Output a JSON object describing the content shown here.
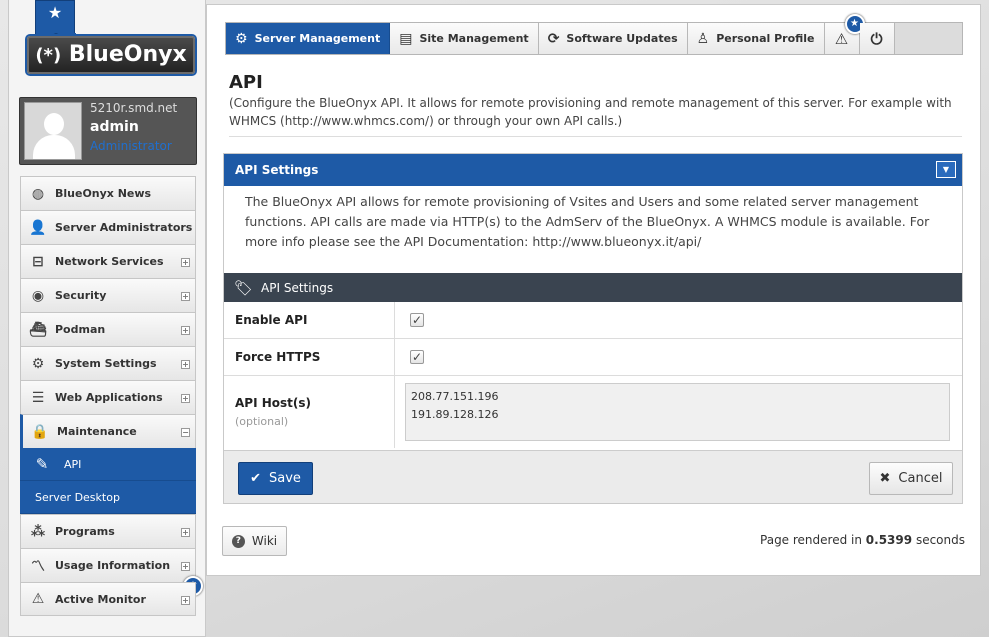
{
  "logo": {
    "brand": "BlueOnyx",
    "mark": "(*)"
  },
  "user": {
    "host": "5210r.smd.net",
    "name": "admin",
    "role": "Administrator"
  },
  "sidebar": {
    "items": [
      {
        "label": "BlueOnyx News",
        "icon": "globe-icon"
      },
      {
        "label": "Server Administrators",
        "icon": "users-icon"
      },
      {
        "label": "Network Services",
        "icon": "network-icon",
        "toggle": "+"
      },
      {
        "label": "Security",
        "icon": "eye-icon",
        "toggle": "+"
      },
      {
        "label": "Podman",
        "icon": "container-icon",
        "toggle": "+"
      },
      {
        "label": "System Settings",
        "icon": "gear-icon",
        "toggle": "+"
      },
      {
        "label": "Web Applications",
        "icon": "server-icon",
        "toggle": "+"
      },
      {
        "label": "Maintenance",
        "icon": "lock-icon",
        "toggle": "−",
        "expanded": true
      },
      {
        "label": "Programs",
        "icon": "programs-icon",
        "toggle": "+"
      },
      {
        "label": "Usage Information",
        "icon": "chart-icon",
        "toggle": "+"
      },
      {
        "label": "Active Monitor",
        "icon": "warning-icon",
        "toggle": "+"
      }
    ],
    "sub_items": [
      {
        "label": "API",
        "active": true
      },
      {
        "label": "Server Desktop"
      }
    ]
  },
  "topnav": {
    "tabs": [
      {
        "label": "Server Management",
        "active": true
      },
      {
        "label": "Site Management"
      },
      {
        "label": "Software Updates"
      },
      {
        "label": "Personal Profile"
      }
    ]
  },
  "page": {
    "title": "API",
    "description": "(Configure the BlueOnyx API. It allows for remote provisioning and remote management of this server. For example with WHMCS (http://www.whmcs.com/) or through your own API calls.)"
  },
  "settings": {
    "header": "API Settings",
    "intro": "The BlueOnyx API allows for remote provisioning of Vsites and Users and some related server management functions. API calls are made via HTTP(s) to the AdmServ of the BlueOnyx. A WHMCS module is available. For more info please see the API Documentation: http://www.blueonyx.it/api/",
    "form_header": "API Settings",
    "enable_api_label": "Enable API",
    "enable_api": true,
    "force_https_label": "Force HTTPS",
    "force_https": true,
    "api_hosts_label": "API Host(s)",
    "api_hosts_optional": "(optional)",
    "api_hosts_value": "208.77.151.196\n191.89.128.126",
    "save_label": "Save",
    "cancel_label": "Cancel"
  },
  "footer": {
    "wiki_label": "Wiki",
    "render_prefix": "Page rendered in",
    "render_seconds": "0.5399",
    "render_suffix": "seconds"
  },
  "colors": {
    "accent": "#1e5aa6",
    "form_header": "#3a4450"
  }
}
